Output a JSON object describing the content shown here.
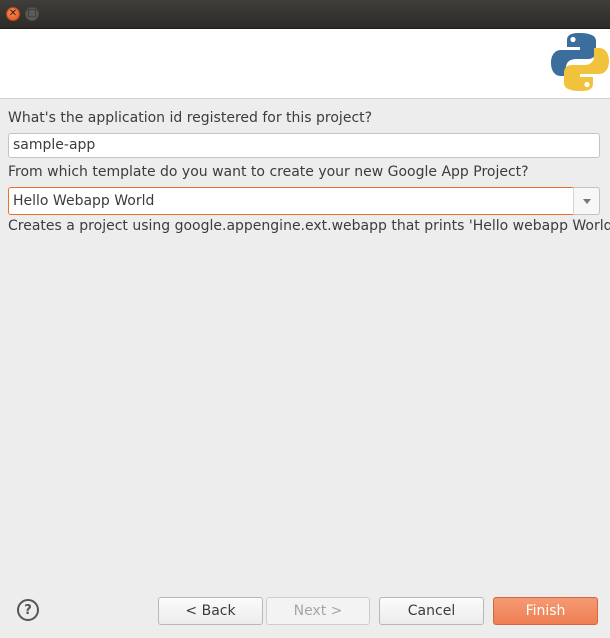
{
  "window": {
    "close_icon": "close-icon",
    "maximize_icon": "maximize-icon"
  },
  "banner": {
    "logo_icon": "python-logo-icon"
  },
  "form": {
    "app_id_label": "What's the application id registered for this project?",
    "app_id_value": "sample-app",
    "template_label": "From which template do you want to create your new Google App Project?",
    "template_value": "Hello Webapp World",
    "template_description": "Creates a project using google.appengine.ext.webapp that prints 'Hello webapp World'"
  },
  "footer": {
    "help_label": "?",
    "back_label": "< Back",
    "next_label": "Next >",
    "cancel_label": "Cancel",
    "finish_label": "Finish"
  },
  "colors": {
    "accent": "#ee7f52",
    "focus_border": "#e9702a",
    "titlebar": "#3a3935"
  }
}
